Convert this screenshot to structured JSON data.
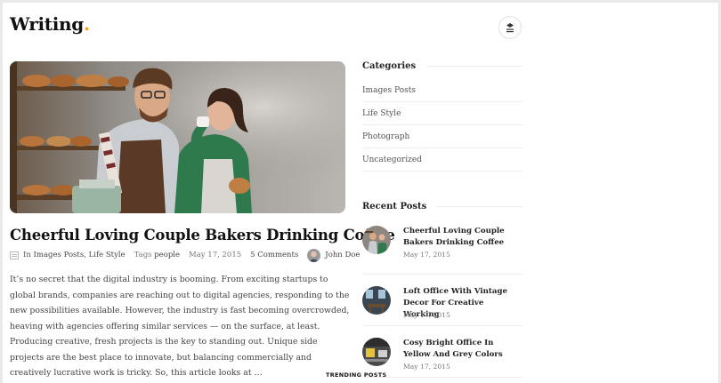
{
  "site": {
    "logo_text": "Writing",
    "logo_dot": ".",
    "accent_color": "#f39c12"
  },
  "header": {
    "menu_icon": "stack-menu-icon"
  },
  "post": {
    "title": "Cheerful Loving Couple Bakers Drinking Coffee",
    "meta": {
      "category_prefix": "In",
      "categories": [
        "Images Posts",
        "Life Style"
      ],
      "tags_prefix": "Tags",
      "tag": "people",
      "date": "May 17, 2015",
      "comments": "5 Comments",
      "author": "John Doe"
    },
    "excerpt": "It’s no secret that the digital industry is booming. From exciting startups to global brands, companies are reaching out to digital agencies, responding to the new possibilities available. However, the industry is fast becoming overcrowded, heaving with agencies offering similar services — on the surface, at least. Producing creative, fresh projects is the key to standing out. Unique side projects are the best place to innovate, but balancing commercially and creatively lucrative work is tricky. So, this article looks at …"
  },
  "sidebar": {
    "categories_title": "Categories",
    "categories": [
      "Images Posts",
      "Life Style",
      "Photograph",
      "Uncategorized"
    ],
    "recent_title": "Recent Posts",
    "recent": [
      {
        "title": "Cheerful Loving Couple Bakers Drinking Coffee",
        "date": "May 17, 2015"
      },
      {
        "title": "Loft Office With Vintage Decor For Creative Working",
        "date": "May 17, 2015"
      },
      {
        "title": "Cosy Bright Office In Yellow And Grey Colors",
        "date": "May 17, 2015"
      }
    ]
  },
  "footer": {
    "trending_label": "TRENDING POSTS"
  }
}
